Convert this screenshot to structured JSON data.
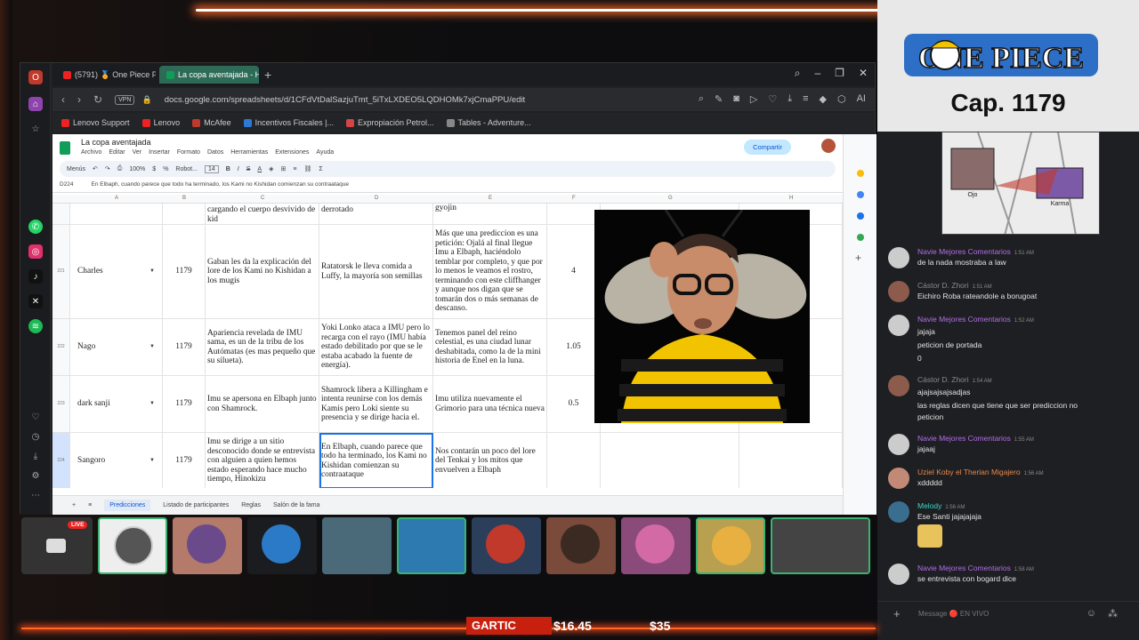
{
  "browser": {
    "tabs": [
      {
        "label": "(5791) 🏅 One Piece POD",
        "active": false
      },
      {
        "label": "La copa aventajada - Hoja",
        "active": true
      }
    ],
    "url": "docs.google.com/spreadsheets/d/1CFdVtDalSazjuTmt_5iTxLXDEO5LQDHOMk7xjCmaPPU/edit",
    "vpn_label": "VPN",
    "bookmarks": [
      "Lenovo Support",
      "Lenovo",
      "McAfee",
      "Incentivos Fiscales |...",
      "Expropiación Petrol...",
      "Tables - Adventure..."
    ]
  },
  "sheets": {
    "title": "La copa aventajada",
    "menus": [
      "Archivo",
      "Editar",
      "Ver",
      "Insertar",
      "Formato",
      "Datos",
      "Herramientas",
      "Extensiones",
      "Ayuda"
    ],
    "share_label": "Compartir",
    "toolbar": {
      "menus_label": "Menús",
      "zoom": "100%",
      "font": "Robot...",
      "font_size": "14"
    },
    "cell_ref": "D224",
    "formula": "En Elbaph, cuando parece que todo ha terminado, los Kami no Kishidan comienzan su contraataque",
    "columns": [
      "A",
      "B",
      "C",
      "D",
      "E",
      "F",
      "G",
      "H"
    ],
    "top_row": {
      "c": "cargando el cuerpo desvivido de kid",
      "d": "derrotado",
      "e": "gyojin"
    },
    "rows": [
      {
        "num": "221",
        "name": "Charles",
        "chapter": "1179",
        "c": "Gaban les da la explicación del lore de los Kami no Kishidan a los mugis",
        "d": "Ratatorsk le lleva comida a Luffy, la mayoría son semillas",
        "e": "Más que una prediccion es una petición: Ojalá al final llegue Imu a Elbaph, haciéndolo temblar por completo, y que por lo menos le veamos el rostro, terminando con este cliffhanger y aunque nos digan que se tomarán dos o más semanas de descanso.",
        "f": "4"
      },
      {
        "num": "222",
        "name": "Nago",
        "chapter": "1179",
        "c": "Apariencia revelada de IMU sama, es un de la tribu de los Autómatas (es mas pequeño que su silueta).",
        "d": "Yoki Lonko ataca a IMU pero lo recarga con el rayo (IMU había estado debilitado por que se le estaba acabado la fuente de energía).",
        "e": "Tenemos panel del reino celestial, es una ciudad lunar deshabitada, como la de la mini historia de Enel en la luna.",
        "f": "1.05"
      },
      {
        "num": "223",
        "name": "dark sanji",
        "chapter": "1179",
        "c": "Imu se apersona en Elbaph junto con Shamrock.",
        "d": "Shamrock libera a Killingham e intenta reunirse con los demás Kamis pero Loki siente su presencia  y se dirige hacia el.",
        "e": "Imu utiliza nuevamente el Grimorio para una técnica nueva",
        "f": "0.5"
      },
      {
        "num": "224",
        "name": "Sangoro",
        "chapter": "1179",
        "c": "Imu se dirige a un sitio desconocido donde se entrevista con alguien a quien hemos estado esperando hace mucho tiempo, Hinokizu",
        "d": "En Elbaph, cuando parece que todo ha terminado, los Kami no Kishidan comienzan su contraataque",
        "e": "Nos contarán un poco del lore del Tenkai y los mitos que envuelven a Elbaph",
        "f": ""
      }
    ],
    "sheet_tabs": [
      "Predicciones",
      "Listado de participantes",
      "Reglas",
      "Salón de la fama"
    ]
  },
  "stream": {
    "header_cap": "Cap. 1179",
    "logo_text": "ONE PIECE",
    "manga_labels": [
      "Ojo",
      "Karma"
    ],
    "live_label": "LIVE",
    "gartic_label": "GARTIC",
    "price_1": "$16.45",
    "price_2": "$35"
  },
  "chat": {
    "messages": [
      {
        "user": "Navie Mejores Comentarios",
        "color": "#b26ee8",
        "time": "1:51 AM",
        "lines": [
          "de la nada mostraba a law"
        ]
      },
      {
        "user": "Cástor D. Zhori",
        "color": "#8a8a8a",
        "time": "1:51 AM",
        "lines": [
          "Eichiro Roba rateandole a borugoat"
        ]
      },
      {
        "user": "Navie Mejores Comentarios",
        "color": "#b26ee8",
        "time": "1:52 AM",
        "lines": [
          "jajaja",
          "peticion de portada",
          "0"
        ]
      },
      {
        "user": "Cástor D. Zhori",
        "color": "#8a8a8a",
        "time": "1:54 AM",
        "lines": [
          "ajajsajsajsadjas",
          "las reglas dicen que tiene que ser prediccion no",
          "peticion"
        ]
      },
      {
        "user": "Navie Mejores Comentarios",
        "color": "#b26ee8",
        "time": "1:55 AM",
        "lines": [
          "jajaaj"
        ]
      },
      {
        "user": "Uziel Koby el Therian Migajero",
        "color": "#e8884a",
        "time": "1:56 AM",
        "lines": [
          "xddddd"
        ]
      },
      {
        "user": "Melody",
        "color": "#3ad6c6",
        "time": "1:56 AM",
        "lines": [
          "Ese Santi jajajajaja"
        ]
      },
      {
        "user": "Navie Mejores Comentarios",
        "color": "#b26ee8",
        "time": "1:58 AM",
        "lines": [
          "se entrevista con bogard dice"
        ]
      }
    ],
    "input_placeholder": "Message 🔴 EN VIVO"
  }
}
